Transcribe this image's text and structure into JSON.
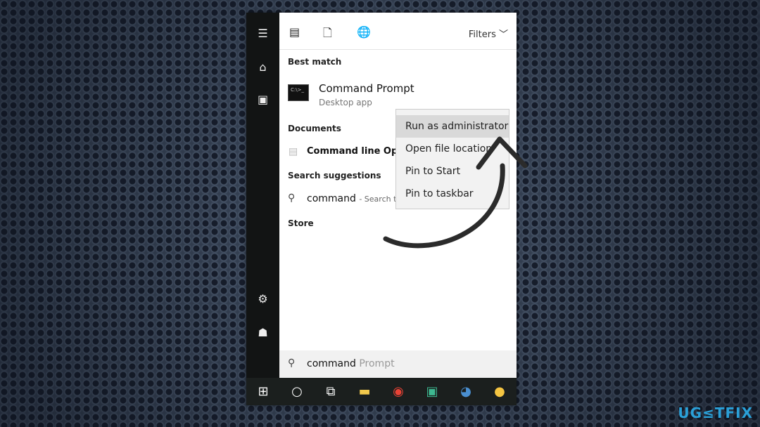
{
  "toolbar": {
    "filters_label": "Filters",
    "icons": [
      "app-icon",
      "document-icon",
      "globe-icon"
    ]
  },
  "sections": {
    "best_match": "Best match",
    "documents": "Documents",
    "search_suggestions": "Search suggestions",
    "store": "Store"
  },
  "best_match": {
    "title": "Command Prompt",
    "subtitle": "Desktop app"
  },
  "document_item": "Command line Opt",
  "suggestion": {
    "query": "command",
    "hint": "- Search th"
  },
  "context_menu": [
    "Run as administrator",
    "Open file location",
    "Pin to Start",
    "Pin to taskbar"
  ],
  "search_box": {
    "typed": "command",
    "completion": "Prompt"
  },
  "taskbar": [
    "start",
    "cortana",
    "task-view",
    "file-explorer",
    "chrome",
    "slack",
    "steam",
    "paint"
  ],
  "watermark": "UG≤TFIX"
}
